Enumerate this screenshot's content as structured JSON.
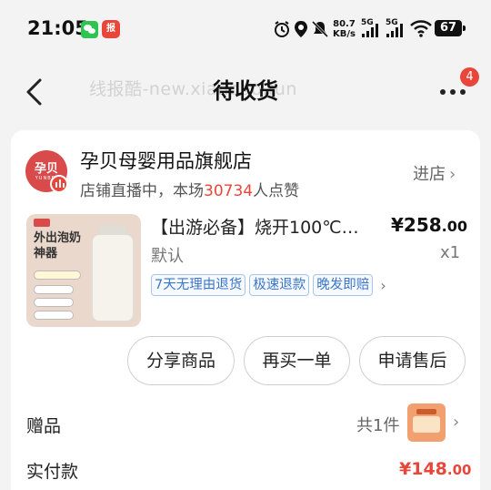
{
  "status_bar": {
    "time": "21:05",
    "app_icon_text": "报",
    "net_speed_value": "80.7",
    "net_speed_unit": "KB/s",
    "sim1": "5G",
    "sim2": "5G",
    "battery": "67",
    "icons": [
      "wechat-icon",
      "app-icon",
      "alarm-icon",
      "location-icon",
      "mute-icon",
      "signal-icon",
      "wifi-icon",
      "battery-icon"
    ]
  },
  "header": {
    "title": "待收货",
    "watermark": "线报酷-new.xianbao.fun",
    "notification_count": "4"
  },
  "store": {
    "name": "孕贝母婴用品旗舰店",
    "sub_prefix": "店铺直播中，本场",
    "likes": "30734",
    "sub_suffix": "人点赞",
    "enter_label": "进店",
    "logo_text": "孕贝",
    "logo_en": "YUNBEI"
  },
  "product": {
    "image_title_line1": "外出泡奶",
    "image_title_line2": "神器",
    "title": "【出游必备】烧开100℃…",
    "price_int": "¥258",
    "price_dec": ".00",
    "spec": "默认",
    "quantity": "x1",
    "tags": [
      "7天无理由退货",
      "极速退款",
      "晚发即赔"
    ]
  },
  "actions": {
    "share": "分享商品",
    "rebuy": "再买一单",
    "after_sale": "申请售后"
  },
  "gift": {
    "label": "赠品",
    "count": "共1件"
  },
  "payment": {
    "label": "实付款",
    "amount_int": "¥148",
    "amount_dec": ".00"
  },
  "colors": {
    "accent": "#e8463a",
    "tag_blue": "#3b76c9",
    "background": "#f3f3f3"
  }
}
